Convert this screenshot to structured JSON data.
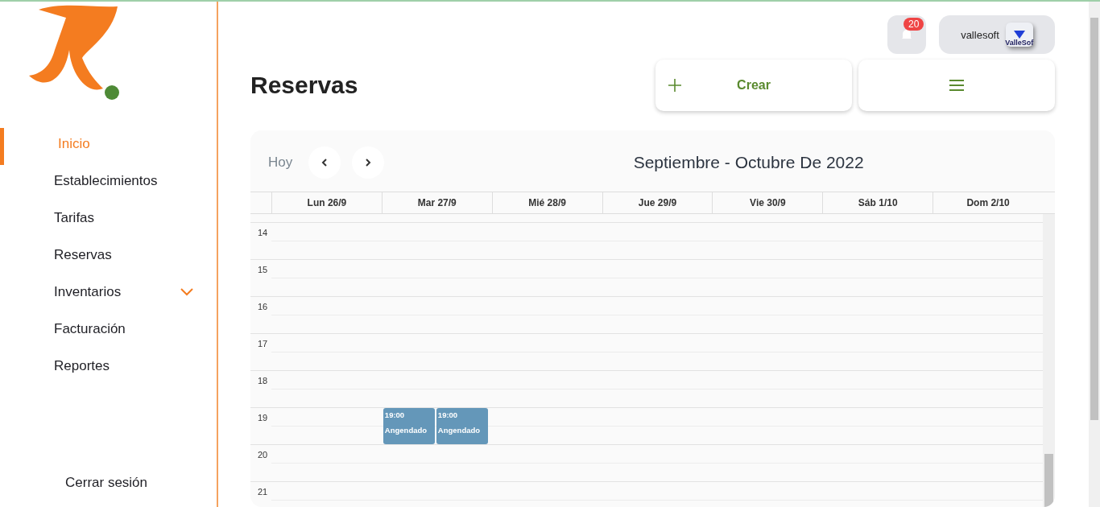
{
  "sidebar": {
    "items": [
      {
        "label": "Inicio",
        "selected": true
      },
      {
        "label": "Establecimientos",
        "selected": false
      },
      {
        "label": "Tarifas",
        "selected": false
      },
      {
        "label": "Reservas",
        "selected": false
      },
      {
        "label": "Inventarios",
        "selected": false,
        "expanded": false
      },
      {
        "label": "Facturación",
        "selected": false
      },
      {
        "label": "Reportes",
        "selected": false
      }
    ],
    "logout": "Cerrar sesión"
  },
  "header": {
    "notifications": "20",
    "user": "vallesoft",
    "user_logo": "ValleSof"
  },
  "page_title": "Reservas",
  "actions": {
    "create": "Crear"
  },
  "calendar": {
    "today": "Hoy",
    "range": "Septiembre - Octubre De 2022",
    "days": [
      "Lun 26/9",
      "Mar 27/9",
      "Mié 28/9",
      "Jue 29/9",
      "Vie 30/9",
      "Sáb 1/10",
      "Dom 2/10"
    ],
    "hours": [
      {
        "label": "14"
      },
      {
        "label": "15"
      },
      {
        "label": "16"
      },
      {
        "label": "17"
      },
      {
        "label": "18"
      },
      {
        "label": "19",
        "cells": [
          [],
          [
            {
              "time": "19:00",
              "title": "Angendado"
            },
            {
              "time": "19:00",
              "title": "Angendado"
            }
          ],
          [],
          [],
          [],
          [],
          []
        ]
      },
      {
        "label": "20"
      },
      {
        "label": "21"
      }
    ]
  }
}
